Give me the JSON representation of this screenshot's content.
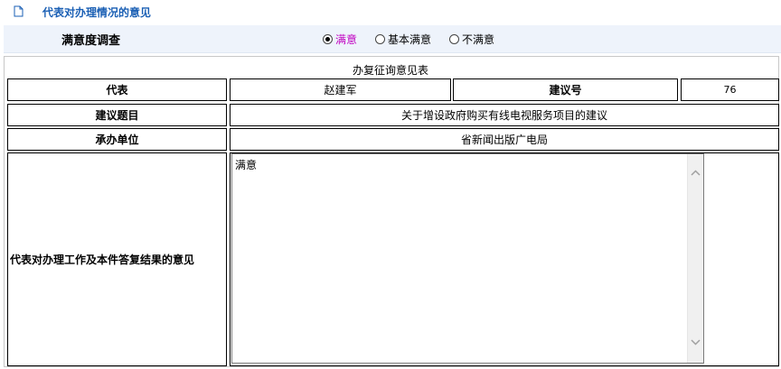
{
  "header": {
    "title": "代表对办理情况的意见",
    "icon": "document-icon"
  },
  "survey": {
    "label": "满意度调查",
    "options": [
      {
        "label": "满意",
        "checked": true
      },
      {
        "label": "基本满意",
        "checked": false
      },
      {
        "label": "不满意",
        "checked": false
      }
    ]
  },
  "table": {
    "caption": "办复征询意见表",
    "rows": {
      "representative_label": "代表",
      "representative_value": "赵建军",
      "suggestion_no_label": "建议号",
      "suggestion_no_value": "76",
      "topic_label": "建议题目",
      "topic_value": "关于增设政府购买有线电视服务项目的建议",
      "unit_label": "承办单位",
      "unit_value": "省新闻出版广电局",
      "opinion_label": "代表对办理工作及本件答复结果的意见",
      "opinion_value": "满意"
    }
  },
  "colors": {
    "header_title": "#1a5fb4",
    "survey_bg": "#eef3fb",
    "selected_option": "#c000c0"
  }
}
